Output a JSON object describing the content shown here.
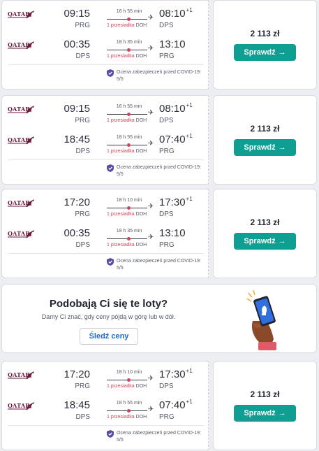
{
  "airline": {
    "name": "QATAR",
    "sub": "AIRWAYS"
  },
  "results": [
    {
      "legs": [
        {
          "dep_time": "09:15",
          "dep_code": "PRG",
          "duration": "16 h 55 min",
          "arr_time": "08:10",
          "arr_offset": "+1",
          "arr_code": "DPS",
          "stops": "1 przesiadka",
          "hub": "DOH"
        },
        {
          "dep_time": "00:35",
          "dep_code": "DPS",
          "duration": "18 h 35 min",
          "arr_time": "13:10",
          "arr_offset": "",
          "arr_code": "PRG",
          "stops": "1 przesiadka",
          "hub": "DOH"
        }
      ],
      "covid": "Ocena zabezpieczeń przed COVID-19: 5/5",
      "price": "2 113 zł",
      "button": "Sprawdź"
    },
    {
      "legs": [
        {
          "dep_time": "09:15",
          "dep_code": "PRG",
          "duration": "16 h 55 min",
          "arr_time": "08:10",
          "arr_offset": "+1",
          "arr_code": "DPS",
          "stops": "1 przesiadka",
          "hub": "DOH"
        },
        {
          "dep_time": "18:45",
          "dep_code": "DPS",
          "duration": "18 h 55 min",
          "arr_time": "07:40",
          "arr_offset": "+1",
          "arr_code": "PRG",
          "stops": "1 przesiadka",
          "hub": "DOH"
        }
      ],
      "covid": "Ocena zabezpieczeń przed COVID-19: 5/5",
      "price": "2 113 zł",
      "button": "Sprawdź"
    },
    {
      "legs": [
        {
          "dep_time": "17:20",
          "dep_code": "PRG",
          "duration": "18 h 10 min",
          "arr_time": "17:30",
          "arr_offset": "+1",
          "arr_code": "DPS",
          "stops": "1 przesiadka",
          "hub": "DOH"
        },
        {
          "dep_time": "00:35",
          "dep_code": "DPS",
          "duration": "18 h 35 min",
          "arr_time": "13:10",
          "arr_offset": "",
          "arr_code": "PRG",
          "stops": "1 przesiadka",
          "hub": "DOH"
        }
      ],
      "covid": "Ocena zabezpieczeń przed COVID-19: 5/5",
      "price": "2 113 zł",
      "button": "Sprawdź"
    },
    {
      "legs": [
        {
          "dep_time": "17:20",
          "dep_code": "PRG",
          "duration": "18 h 10 min",
          "arr_time": "17:30",
          "arr_offset": "+1",
          "arr_code": "DPS",
          "stops": "1 przesiadka",
          "hub": "DOH"
        },
        {
          "dep_time": "18:45",
          "dep_code": "DPS",
          "duration": "18 h 55 min",
          "arr_time": "07:40",
          "arr_offset": "+1",
          "arr_code": "PRG",
          "stops": "1 przesiadka",
          "hub": "DOH"
        }
      ],
      "covid": "Ocena zabezpieczeń przed COVID-19: 5/5",
      "price": "2 113 zł",
      "button": "Sprawdź"
    }
  ],
  "promo": {
    "title": "Podobają Ci się te loty?",
    "subtitle": "Damy Ci znać, gdy ceny pójdą w górę lub w dół.",
    "button": "Śledź ceny"
  },
  "colors": {
    "accent": "#0f9f92",
    "stop_red": "#d1435b",
    "link_blue": "#1b6bd1",
    "airline": "#6b1a3a"
  },
  "icons": [
    "qatar-logo",
    "plane-icon",
    "shield-check-icon",
    "arrow-right-icon",
    "hand-phone-illustration"
  ]
}
